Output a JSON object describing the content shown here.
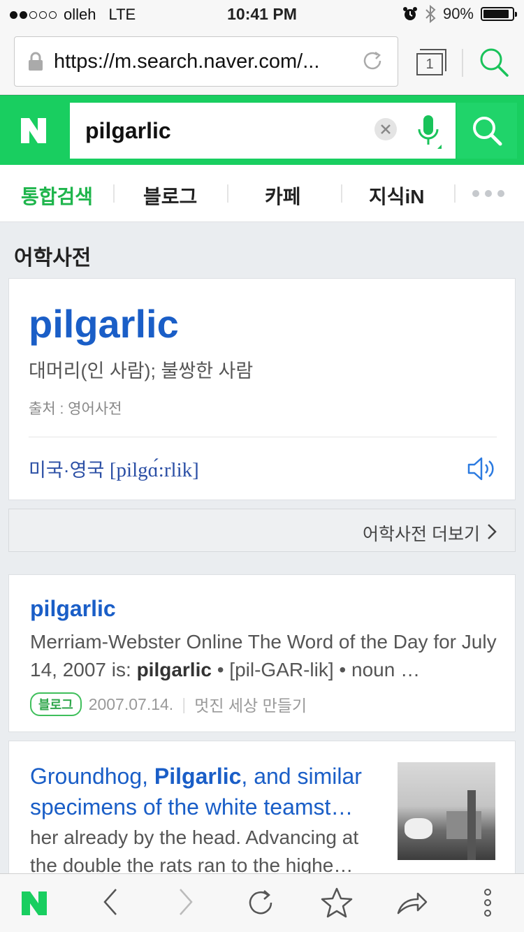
{
  "status_bar": {
    "carrier": "olleh",
    "network": "LTE",
    "time": "10:41 PM",
    "battery": "90%",
    "battery_level": 0.9
  },
  "browser": {
    "url": "https://m.search.naver.com/...",
    "tab_count": "1"
  },
  "search": {
    "query": "pilgarlic"
  },
  "menu": {
    "tabs": [
      "통합검색",
      "블로그",
      "카페",
      "지식iN"
    ],
    "active_index": 0
  },
  "dictionary": {
    "section_title": "어학사전",
    "word": "pilgarlic",
    "meaning": "대머리(인 사람); 불쌍한 사람",
    "source": "출처 : 영어사전",
    "pron_label": "미국·영국",
    "pronunciation": "[pilgɑ́:rlik]",
    "more_label": "어학사전 더보기"
  },
  "results": [
    {
      "title": "pilgarlic",
      "desc_pre": "Merriam-Webster Online The Word of the Day for July 14, 2007 is: ",
      "desc_bold": "pilgarlic",
      "desc_post": " • [pil-GAR-lik] • noun …",
      "badge": "블로그",
      "date": "2007.07.14.",
      "blog_name": "멋진 세상 만들기"
    },
    {
      "title_pre": "Groundhog, ",
      "title_bold": "Pilgarlic",
      "title_post": ", and similar specimens of the white teamst…",
      "desc": "her already by the head. Advancing at the double the rats ran to the highe…"
    }
  ],
  "colors": {
    "naver_green": "#19ce60",
    "link_blue": "#1a5ec7",
    "active_tab": "#1fb54c"
  }
}
